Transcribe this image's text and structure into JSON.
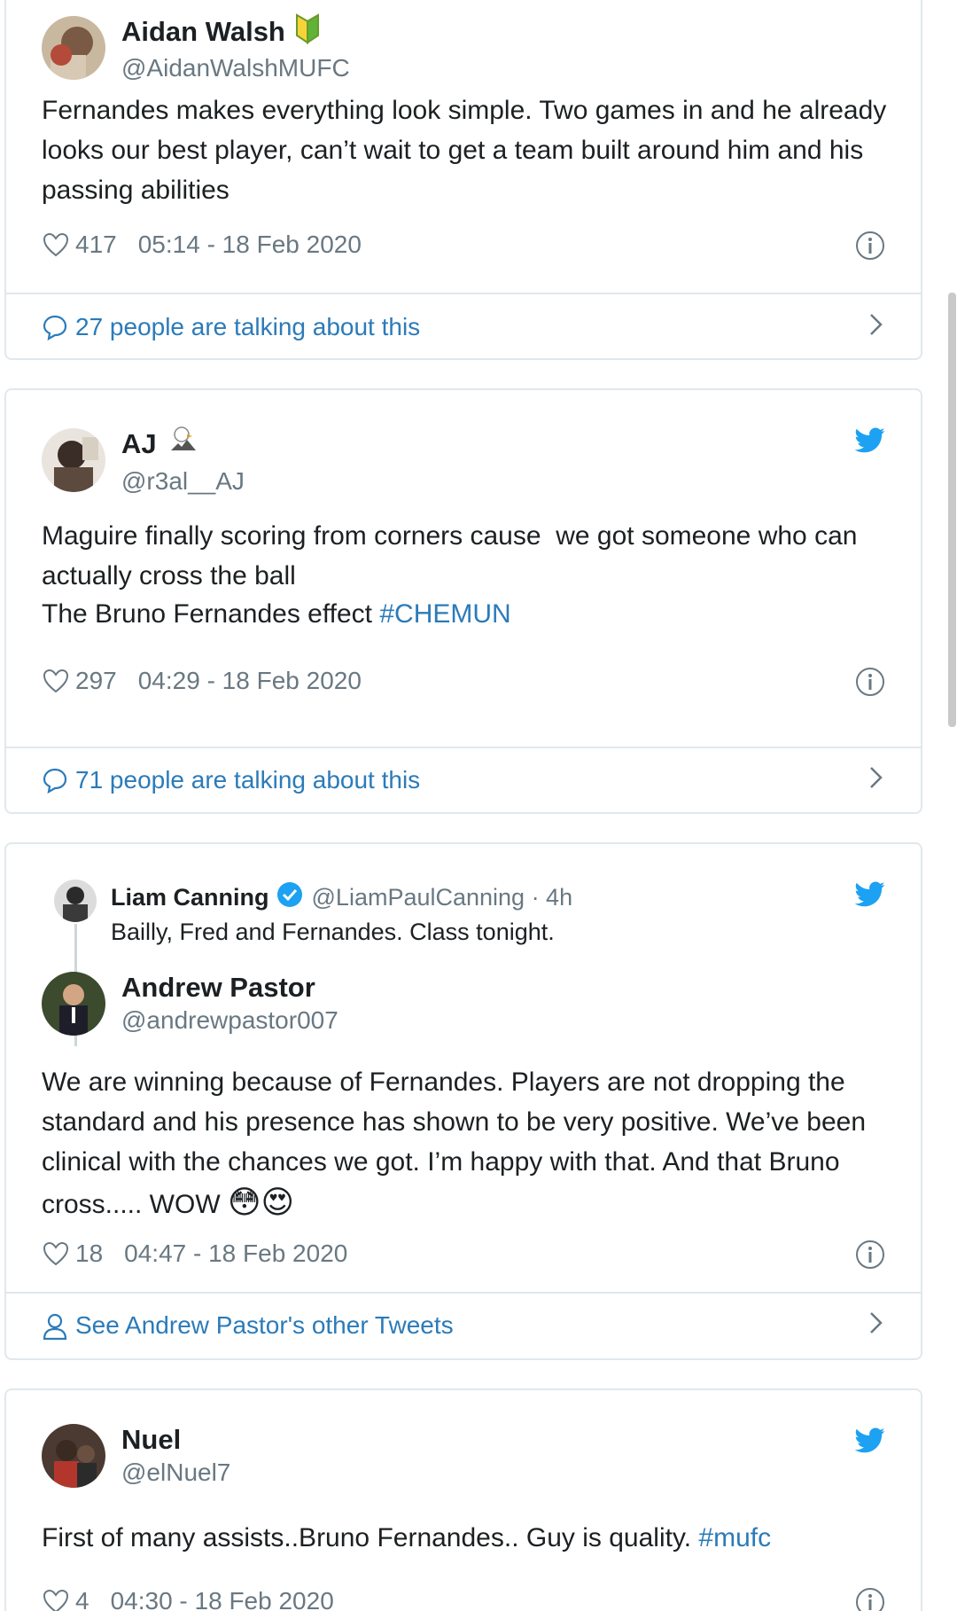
{
  "tweets": [
    {
      "name": "Aidan Walsh",
      "handle": "@AidanWalshMUFC",
      "text": "Fernandes makes everything look simple. Two games in and he already looks our best player, can’t wait to get a team built around him and his passing abilities",
      "likes": "417",
      "time": "05:14 - 18 Feb 2020",
      "footer": "27 people are talking about this"
    },
    {
      "name": "AJ",
      "handle": "@r3al__AJ",
      "text_line1": "Maguire finally scoring from corners cause  we got someone who can actually cross the ball",
      "text_line2": "The Bruno Fernandes effect ",
      "hashtag": "#CHEMUN",
      "likes": "297",
      "time": "04:29 - 18 Feb 2020",
      "footer": "71 people are talking about this"
    },
    {
      "quoted_name": "Liam Canning",
      "quoted_handle": "@LiamPaulCanning · 4h",
      "quoted_text": "Bailly, Fred and Fernandes. Class tonight.",
      "name": "Andrew Pastor",
      "handle": "@andrewpastor007",
      "text": "We are winning because of Fernandes. Players are not dropping the standard and his presence has shown to be very positive. We’ve been clinical with the chances we got. I’m happy with that. And that Bruno cross..... WOW ",
      "emoji": "😳😍",
      "likes": "18",
      "time": "04:47 - 18 Feb 2020",
      "footer": "See Andrew Pastor's other Tweets"
    },
    {
      "name": "Nuel",
      "handle": "@elNuel7",
      "text": "First of many assists..Bruno Fernandes.. Guy is quality. ",
      "hashtag": "#mufc",
      "likes": "4",
      "time": "04:30 - 18 Feb 2020"
    }
  ],
  "colors": {
    "link": "#2b7bb9",
    "twitter_blue": "#1da1f2",
    "muted": "#697882",
    "border": "#e1e8ed"
  }
}
